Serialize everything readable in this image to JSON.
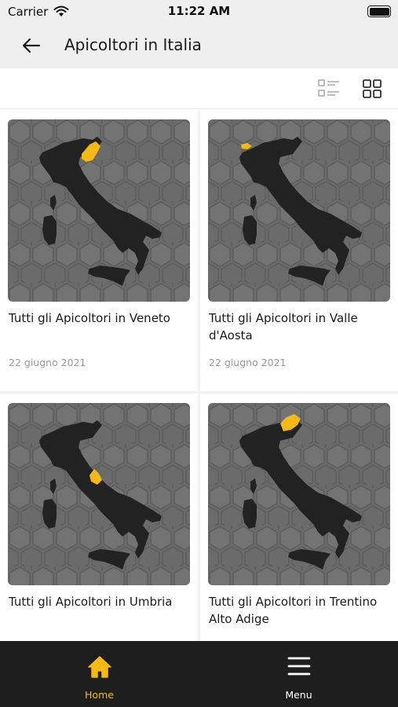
{
  "status_bar": {
    "carrier": "Carrier",
    "time": "11:22 AM"
  },
  "nav": {
    "title": "Apicoltori in Italia",
    "back_icon": "arrow-left-icon"
  },
  "view_toggle": {
    "list_icon": "list-view-icon",
    "grid_icon": "grid-view-icon",
    "active": "grid"
  },
  "colors": {
    "accent": "#f5b916",
    "tab_bar": "#1e1e1e",
    "map_bg": "#6a6a6a",
    "map_land": "#222222"
  },
  "cards": [
    {
      "title": "Tutti gli Apicoltori in Veneto",
      "date": "22 giugno 2021",
      "region": "Veneto"
    },
    {
      "title": "Tutti gli Apicoltori in Valle d'Aosta",
      "date": "22 giugno 2021",
      "region": "Valle d'Aosta"
    },
    {
      "title": "Tutti gli Apicoltori in Umbria",
      "date": "",
      "region": "Umbria"
    },
    {
      "title": "Tutti gli Apicoltori in Trentino Alto Adige",
      "date": "",
      "region": "Trentino Alto Adige"
    }
  ],
  "tabs": [
    {
      "label": "Home",
      "icon": "home-icon",
      "active": true
    },
    {
      "label": "Menu",
      "icon": "hamburger-menu-icon",
      "active": false
    }
  ]
}
